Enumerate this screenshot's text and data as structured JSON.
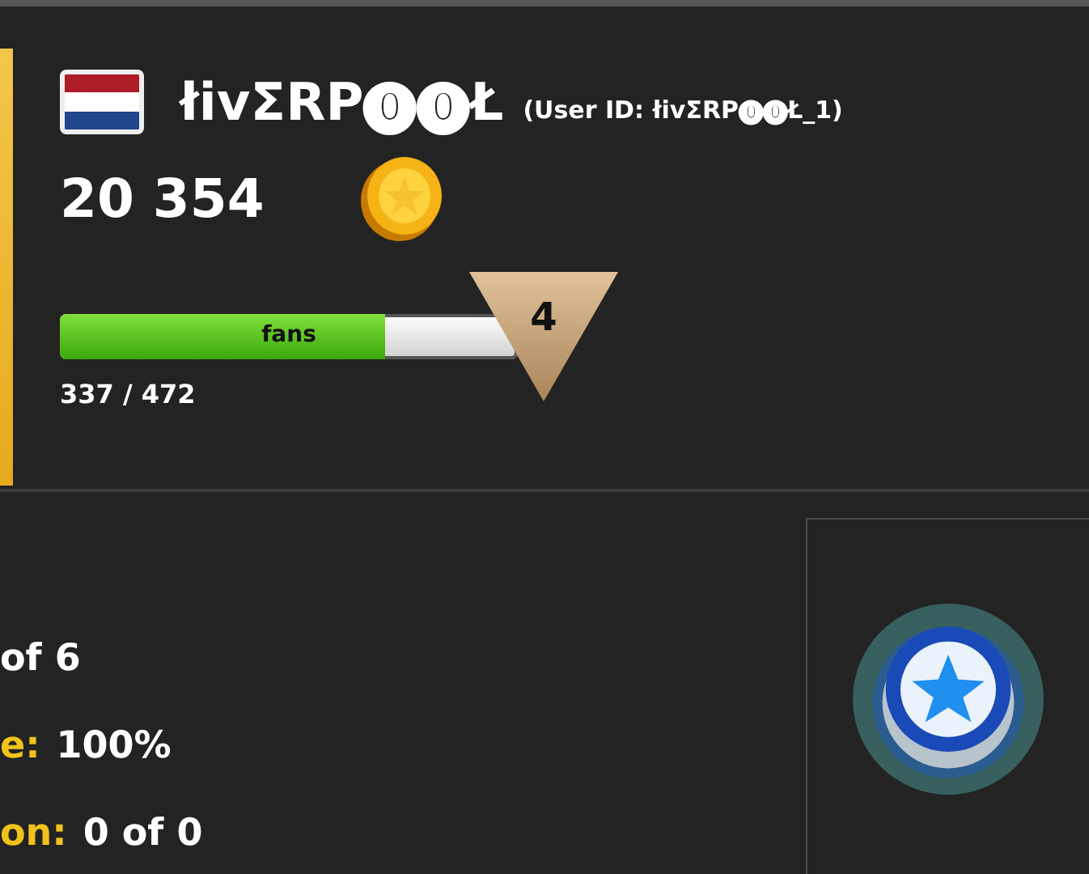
{
  "profile": {
    "flag": {
      "kind": "tricolor"
    },
    "name": "łivΣRP⓿⓿Ł",
    "user_id": "(User ID: łivΣRP⓿⓿Ł_1)",
    "coins": "20 354",
    "fans": {
      "label": "fans",
      "level": 0.71,
      "reading": "337 / 472",
      "rank": "4"
    }
  },
  "stats": [
    {
      "value": "of 6"
    },
    {
      "label": "e:",
      "value": "100%"
    },
    {
      "label": "on:",
      "value": "0 of 0"
    }
  ],
  "badge": {
    "kind": "star"
  }
}
